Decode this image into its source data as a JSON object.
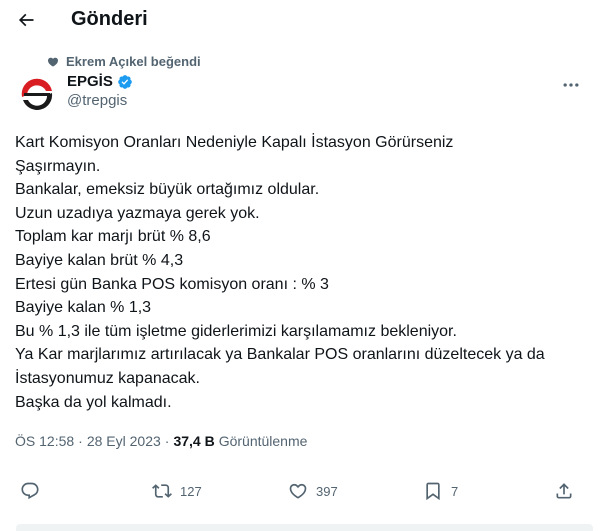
{
  "header": {
    "title": "Gönderi"
  },
  "social_context": {
    "text": "Ekrem Açıkel beğendi"
  },
  "author": {
    "name": "EPGİS",
    "handle": "@trepgis",
    "verified": true
  },
  "tweet": {
    "text": "Kart Komisyon Oranları Nedeniyle Kapalı İstasyon Görürseniz\nŞaşırmayın.\nBankalar, emeksiz büyük ortağımız oldular.\nUzun uzadıya yazmaya gerek yok.\nToplam kar marjı brüt % 8,6\nBayiye kalan brüt % 4,3\nErtesi gün Banka POS komisyon oranı : % 3\nBayiye kalan % 1,3\nBu % 1,3 ile tüm işletme giderlerimizi karşılamamız bekleniyor.\nYa Kar marjlarımız artırılacak ya Bankalar POS oranlarını düzeltecek ya da\nİstasyonumuz kapanacak.\nBaşka da yol kalmadı."
  },
  "meta": {
    "time": "ÖS 12:58",
    "separator": "·",
    "date": "28 Eyl 2023",
    "views_count": "37,4 B",
    "views_label": "Görüntülenme"
  },
  "actions": {
    "reply_count": "",
    "retweet_count": "127",
    "like_count": "397",
    "bookmark_count": "7"
  },
  "colors": {
    "text": "#0f1419",
    "secondary": "#536471",
    "verified": "#1d9bf0",
    "logo_red": "#d81e23",
    "logo_dark": "#1a1a1a"
  }
}
